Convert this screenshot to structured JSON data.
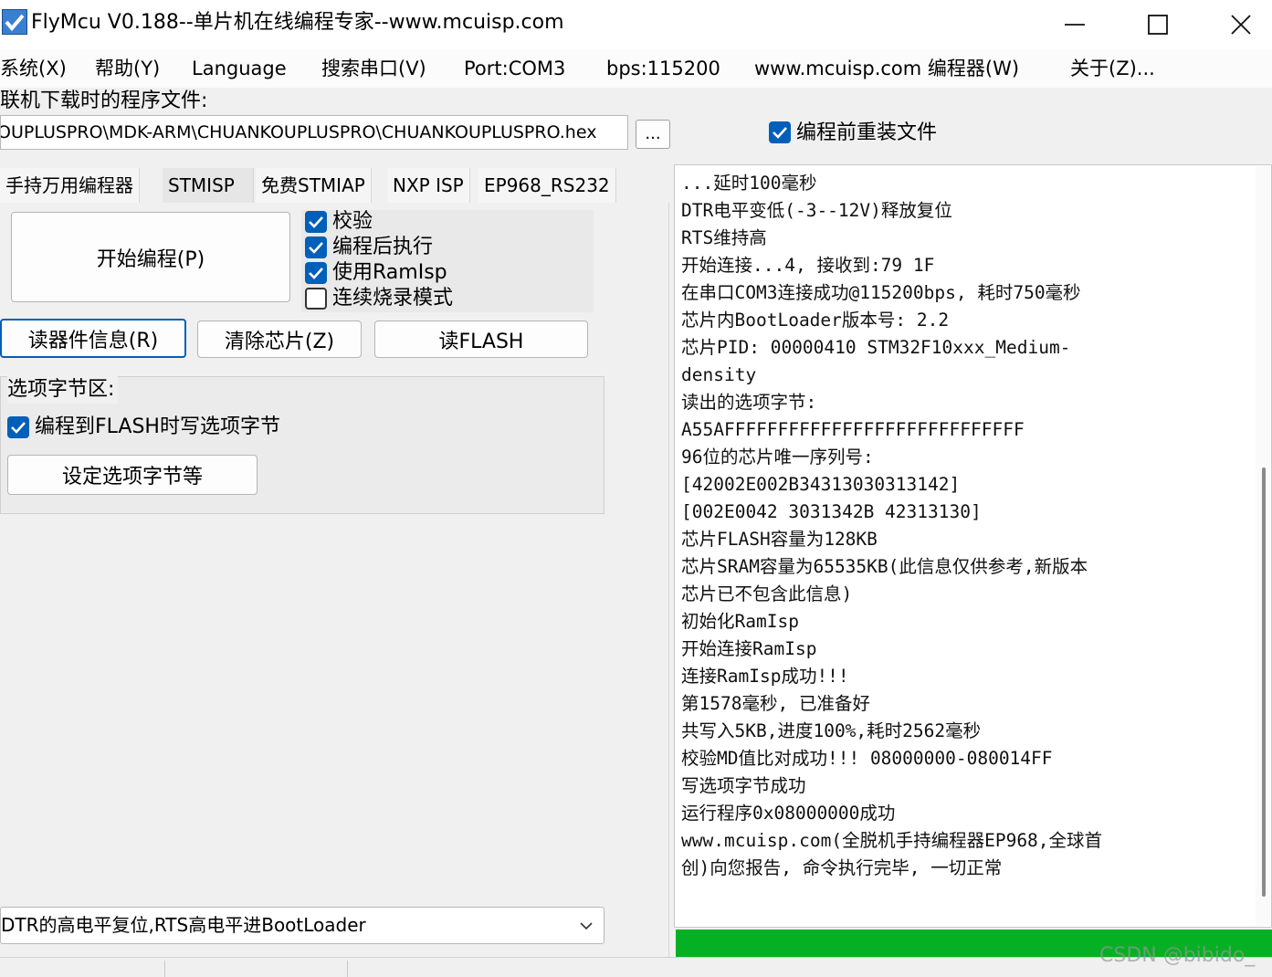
{
  "window": {
    "title": "FlyMcu V0.188--单片机在线编程专家--www.mcuisp.com",
    "icon": "flymcu-check-icon"
  },
  "menu": [
    "系统(X)",
    "帮助(Y)",
    "Language",
    "搜索串口(V)",
    "Port:COM3",
    "bps:115200",
    "www.mcuisp.com 编程器(W)",
    "关于(Z)..."
  ],
  "file": {
    "label": "联机下载时的程序文件:",
    "path": "OUPLUSPRO\\MDK-ARM\\CHUANKOUPLUSPRO\\CHUANKOUPLUSPRO.hex",
    "browse_label": "...",
    "reload_label": "编程前重装文件",
    "reload_checked": true
  },
  "tabs": [
    {
      "label": "手持万用编程器",
      "active": false
    },
    {
      "label": "STMISP",
      "active": true
    },
    {
      "label": "免费STMIAP",
      "active": false
    },
    {
      "label": "NXP ISP",
      "active": false
    },
    {
      "label": "EP968_RS232",
      "active": false
    }
  ],
  "buttons": {
    "start": "开始编程(P)",
    "read_info": "读器件信息(R)",
    "erase": "清除芯片(Z)",
    "read_flash": "读FLASH",
    "set_options": "设定选项字节等"
  },
  "options": [
    {
      "label": "校验",
      "checked": true
    },
    {
      "label": "编程后执行",
      "checked": true
    },
    {
      "label": "使用RamIsp",
      "checked": true
    },
    {
      "label": "连续烧录模式",
      "checked": false
    }
  ],
  "option_bytes": {
    "title": "选项字节区:",
    "write_label": "编程到FLASH时写选项字节",
    "write_checked": true
  },
  "dtr_mode": {
    "selected": "DTR的高电平复位,RTS高电平进BootLoader"
  },
  "log": [
    "...延时100毫秒",
    "DTR电平变低(-3--12V)释放复位",
    "RTS维持高",
    "开始连接...4, 接收到:79 1F",
    "在串口COM3连接成功@115200bps, 耗时750毫秒",
    "芯片内BootLoader版本号: 2.2",
    "芯片PID: 00000410  STM32F10xxx_Medium-",
    "density",
    "读出的选项字节:",
    "A55AFFFFFFFFFFFFFFFFFFFFFFFFFFFF",
    "96位的芯片唯一序列号:",
    "[42002E002B34313030313142]",
    "[002E0042 3031342B 42313130]",
    "芯片FLASH容量为128KB",
    "芯片SRAM容量为65535KB(此信息仅供参考,新版本",
    "芯片已不包含此信息)",
    "初始化RamIsp",
    "开始连接RamIsp",
    "连接RamIsp成功!!!",
    "第1578毫秒, 已准备好",
    "共写入5KB,进度100%,耗时2562毫秒",
    "校验MD值比对成功!!! 08000000-080014FF",
    "写选项字节成功",
    "运行程序0x08000000成功",
    "www.mcuisp.com(全脱机手持编程器EP968,全球首",
    "创)向您报告, 命令执行完毕, 一切正常"
  ],
  "progress": {
    "percent": 100,
    "color": "#06b025"
  },
  "watermark": "CSDN @bibido_",
  "colors": {
    "accent": "#005fb8",
    "progress": "#06b025"
  }
}
